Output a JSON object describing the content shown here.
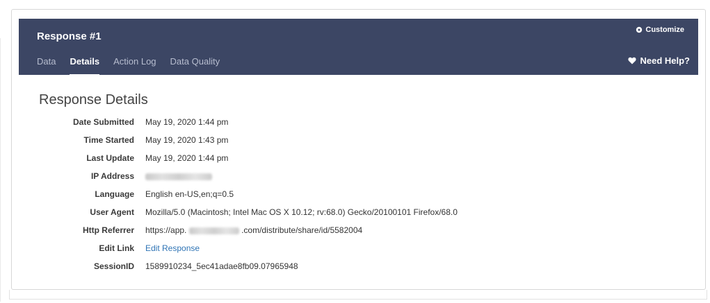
{
  "header": {
    "title": "Response #1",
    "customize_label": "Customize",
    "need_help_label": "Need Help?",
    "tabs": [
      {
        "label": "Data",
        "active": false
      },
      {
        "label": "Details",
        "active": true
      },
      {
        "label": "Action Log",
        "active": false
      },
      {
        "label": "Data Quality",
        "active": false
      }
    ]
  },
  "details": {
    "title": "Response Details",
    "rows": [
      {
        "label": "Date Submitted",
        "value": "May 19, 2020 1:44 pm"
      },
      {
        "label": "Time Started",
        "value": "May 19, 2020 1:43 pm"
      },
      {
        "label": "Last Update",
        "value": "May 19, 2020 1:44 pm"
      },
      {
        "label": "IP Address",
        "value": ""
      },
      {
        "label": "Language",
        "value": "English en-US,en;q=0.5"
      },
      {
        "label": "User Agent",
        "value": "Mozilla/5.0 (Macintosh; Intel Mac OS X 10.12; rv:68.0) Gecko/20100101 Firefox/68.0"
      },
      {
        "label": "Http Referrer",
        "value_prefix": "https://app.",
        "value_suffix": ".com/distribute/share/id/5582004"
      },
      {
        "label": "Edit Link",
        "value": "Edit Response"
      },
      {
        "label": "SessionID",
        "value": "1589910234_5ec41adae8fb09.07965948"
      }
    ]
  },
  "colors": {
    "header_bg": "#3c4664",
    "link": "#2f74b5"
  },
  "icons": {
    "customize": "gear-icon",
    "need_help": "heart-icon"
  }
}
